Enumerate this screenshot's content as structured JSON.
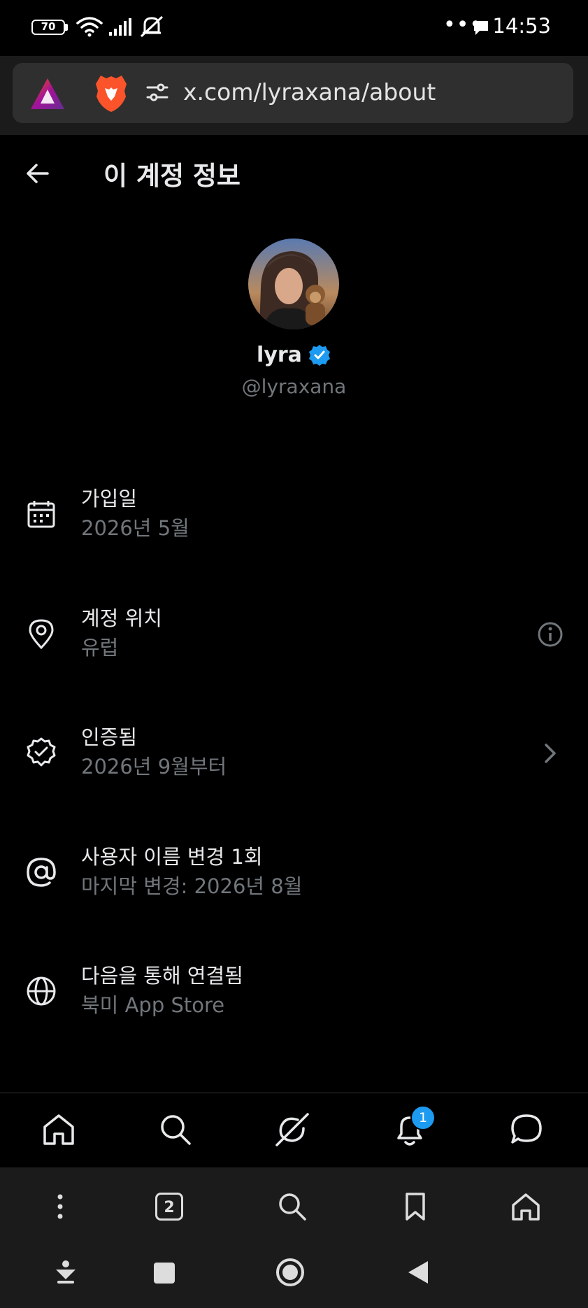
{
  "status_bar": {
    "battery": "70",
    "overflow": "•••",
    "time": "14:53"
  },
  "browser": {
    "url": "x.com/lyraxana/about",
    "tab_count": "2"
  },
  "header": {
    "title": "이 계정 정보"
  },
  "profile": {
    "display_name": "lyra",
    "handle": "@lyraxana",
    "verified": true,
    "verified_color": "#1d9bf0"
  },
  "info_rows": [
    {
      "icon": "calendar-icon",
      "label": "가입일",
      "value": "2026년 5월"
    },
    {
      "icon": "location-pin-icon",
      "label": "계정 위치",
      "value": "유럽",
      "trailing": "info-icon"
    },
    {
      "icon": "verified-badge-icon",
      "label": "인증됨",
      "value": "2026년 9월부터",
      "trailing": "chevron-right-icon"
    },
    {
      "icon": "at-sign-icon",
      "label": "사용자 이름 변경 1회",
      "value": "마지막 변경: 2026년 8월"
    },
    {
      "icon": "globe-icon",
      "label": "다음을 통해 연결됨",
      "value": "북미 App Store"
    }
  ],
  "tab_bar": {
    "items": [
      "home-icon",
      "search-icon",
      "grok-icon",
      "notifications-icon",
      "messages-icon"
    ],
    "notification_count": "1"
  },
  "browser_toolbar": {
    "items": [
      "menu-icon",
      "tabs-icon",
      "search-icon",
      "bookmark-icon",
      "home-icon"
    ]
  },
  "android_nav": {
    "items": [
      "download-icon",
      "recents-icon",
      "home-icon",
      "back-icon"
    ]
  }
}
